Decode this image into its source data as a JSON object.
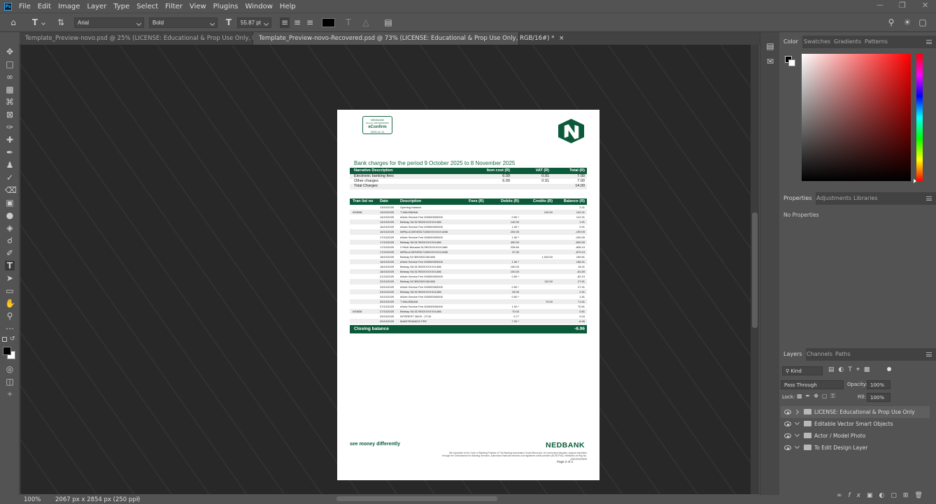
{
  "app": {
    "logo_text": "Ps"
  },
  "menu": [
    "File",
    "Edit",
    "Image",
    "Layer",
    "Type",
    "Select",
    "Filter",
    "View",
    "Plugins",
    "Window",
    "Help"
  ],
  "options": {
    "font_family": "Arial",
    "font_style": "Bold",
    "font_size": "55.87 pt"
  },
  "tabs": [
    {
      "label": "Template_Preview-novo.psd @ 25% (LICENSE: Educational & Prop Use Only, RGB/16#)",
      "active": false
    },
    {
      "label": "Template_Preview-novo-Recovered.psd @ 73% (LICENSE: Educational & Prop Use Only, RGB/16#) *",
      "active": true
    }
  ],
  "status": {
    "zoom": "100%",
    "doc_info": "2067 px x 2854 px (250 ppi)"
  },
  "document": {
    "stamp": {
      "bank": "NEDBANK",
      "line2": "Reg No 1951/000009/06",
      "title": "eConfirm",
      "date": "2025-11-11"
    },
    "title": "Bank charges for the period 9 October 2025 to 8 November 2025",
    "summary_headers": [
      "Narrative Description",
      "Item cost (R)",
      "VAT (R)",
      "Total (R)"
    ],
    "summary_rows": [
      [
        "Electronic banking fees",
        "6.09",
        "0.91",
        "7.00"
      ],
      [
        "Other charges",
        "6.09",
        "0.91",
        "7.00"
      ],
      [
        "Total Charges",
        "",
        "",
        "14.00"
      ]
    ],
    "txn_headers": [
      "Tran list no",
      "Date",
      "Description",
      "Fees (R)",
      "Debits (R)",
      "Credits (R)",
      "Balance (R)"
    ],
    "txn_rows": [
      [
        "",
        "13/10/2025",
        "Opening balance",
        "",
        "",
        "",
        "2.41"
      ],
      [
        "000838",
        "13/10/2025",
        "T MALEBANA",
        "",
        "",
        "140.00",
        "142.41"
      ],
      [
        "",
        "14/10/2025",
        "eNote Service Fee 000000000000",
        "",
        "0.50 *",
        "",
        "141.91"
      ],
      [
        "",
        "14/10/2025",
        "Betway SA 517892XXXXXX1486",
        "",
        "140.00",
        "",
        "1.91"
      ],
      [
        "",
        "16/10/2025",
        "eNote Service Fee 000000000000",
        "",
        "1.00 *",
        "",
        "0.91"
      ],
      [
        "",
        "16/10/2025",
        "IMPALA DIENS5171892XXXXXX1486",
        "",
        "200.00",
        "",
        "-199.09"
      ],
      [
        "",
        "17/10/2025",
        "eNote Service Fee 000000000000",
        "",
        "1.50 *",
        "",
        "-200.59"
      ],
      [
        "",
        "17/10/2025",
        "Betway SA 517892XXXXXX1486",
        "",
        "400.00",
        "",
        "-600.59"
      ],
      [
        "",
        "17/10/2025",
        "C*McD Mooana 517892XXXXXX1486",
        "",
        "235.60",
        "",
        "-836.19"
      ],
      [
        "",
        "17/10/2025",
        "IMPALA DIENS5171892XXXXXX1486",
        "",
        "37.00",
        "",
        "-873.19"
      ],
      [
        "",
        "18/10/2025",
        "Betway 5178920022461486",
        "",
        "",
        "1,043.00",
        "169.81"
      ],
      [
        "",
        "18/10/2025",
        "eNote Service Fee 000000000000",
        "",
        "1.50 *",
        "",
        "168.31"
      ],
      [
        "",
        "18/10/2025",
        "Betway SA 517892XXXXXX1486",
        "",
        "150.00",
        "",
        "18.31"
      ],
      [
        "",
        "18/10/2025",
        "Betway SA 517892XXXXXX1486",
        "",
        "100.00",
        "",
        "-81.69"
      ],
      [
        "",
        "21/10/2025",
        "eNote Service Fee 000000000000",
        "",
        "0.50 *",
        "",
        "-82.19"
      ],
      [
        "",
        "22/10/2025",
        "Betway 5178920022461486",
        "",
        "",
        "110.00",
        "27.81"
      ],
      [
        "",
        "23/10/2025",
        "eNote Service Fee 000000000000",
        "",
        "0.50 *",
        "",
        "27.31"
      ],
      [
        "",
        "23/10/2025",
        "Betway SA 517892XXXXXX1486",
        "",
        "25.00",
        "",
        "2.31"
      ],
      [
        "",
        "24/10/2025",
        "eNote Service Fee 000000000000",
        "",
        "0.50 *",
        "",
        "1.81"
      ],
      [
        "",
        "25/10/2025",
        "T MALEBANA",
        "",
        "",
        "70.00",
        "71.81"
      ],
      [
        "",
        "27/10/2025",
        "eNote Service Fee 000000000000",
        "",
        "1.00 *",
        "",
        "70.81"
      ],
      [
        "000838",
        "27/10/2025",
        "Betway SA 517892XXXXXX1486",
        "",
        "70.00",
        "",
        "0.81"
      ],
      [
        "",
        "29/10/2025",
        "INTEREST 26/09 - 27/10",
        "",
        "0.77",
        "",
        "0.04"
      ],
      [
        "",
        "29/10/2025",
        "MAINTENANCE FEE",
        "",
        "7.00 *",
        "",
        "-6.96"
      ]
    ],
    "closing_label": "Closing balance",
    "closing_value": "-6.96",
    "slogan": "see money differently",
    "brand": "NEDBANK",
    "footnote": "We subscribe to the Code of Banking Practice of The Banking Association South Africa and, for unresolved disputes, support resolution through the Ombudsman for Banking Services. Authorised financial services and registered credit provider (NCRCP16). Nedbank Ltd Reg No. 1951/000009/06",
    "page": "Page 2 of 2"
  },
  "panels": {
    "color_tabs": [
      "Color",
      "Swatches",
      "Gradients",
      "Patterns"
    ],
    "prop_tabs": [
      "Properties",
      "Adjustments",
      "Libraries"
    ],
    "no_props": "No Properties",
    "layers_tabs": [
      "Layers",
      "Channels",
      "Paths"
    ],
    "kind": "Kind",
    "blend": "Pass Through",
    "opacity_label": "Opacity:",
    "opacity": "100%",
    "lock_label": "Lock:",
    "fill_label": "Fill:",
    "fill": "100%",
    "layers": [
      {
        "name": "LICENSE: Educational & Prop Use Only",
        "open": false
      },
      {
        "name": "Editable Vector Smart Objects",
        "open": true
      },
      {
        "name": "Actor / Model Photo",
        "open": true
      },
      {
        "name": "To Edit Design Layer",
        "open": true
      }
    ]
  }
}
